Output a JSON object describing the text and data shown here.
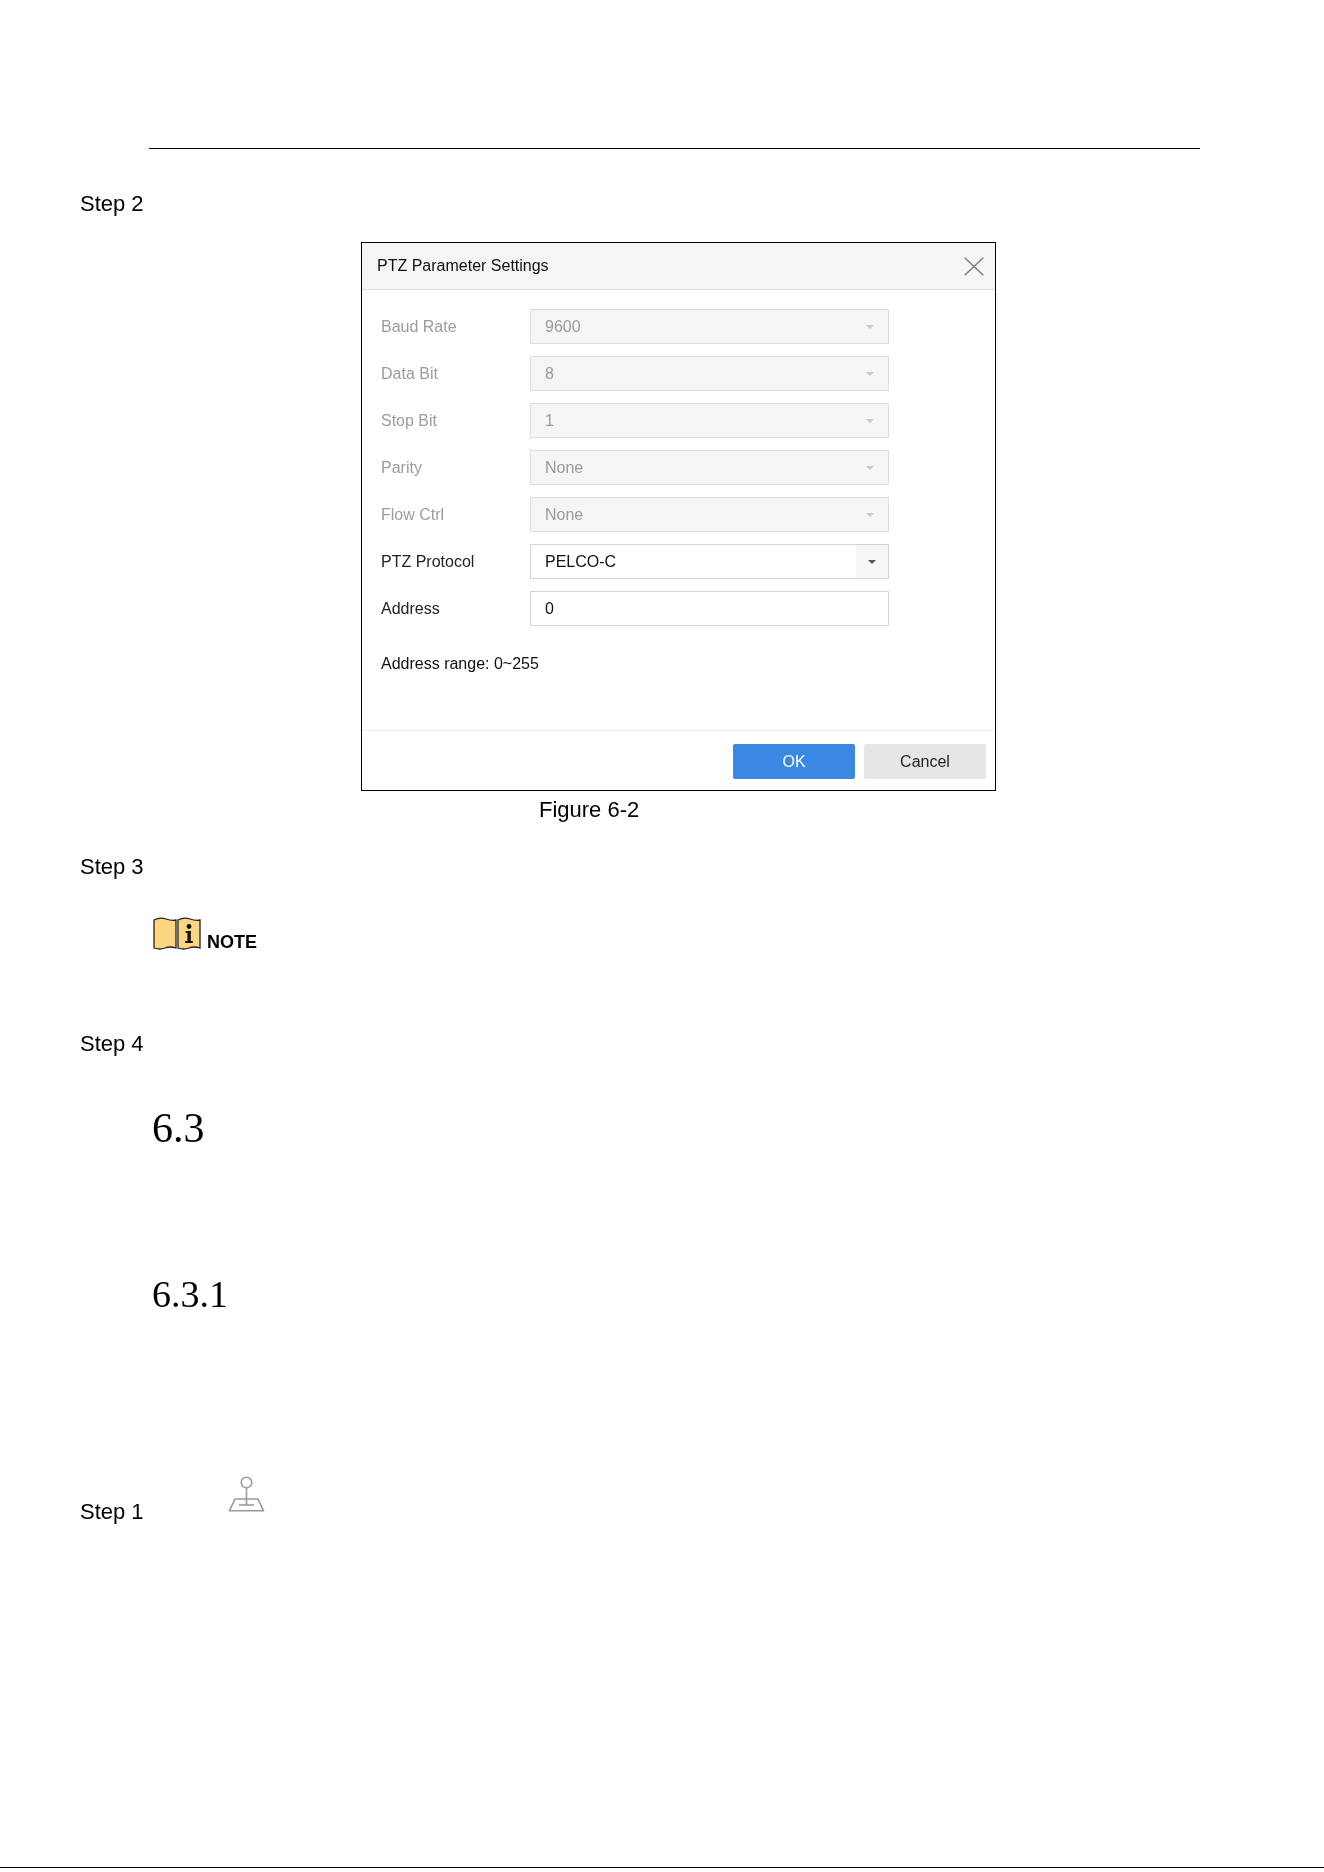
{
  "content": [
    {
      "kind": "step",
      "label": "Step 2"
    },
    {
      "kind": "dialog",
      "title": "PTZ Parameter Settings",
      "fields": [
        {
          "label": "Baud Rate",
          "kind": "select",
          "value": "9600",
          "disabled": true
        },
        {
          "label": "Data Bit",
          "kind": "select",
          "value": "8",
          "disabled": true
        },
        {
          "label": "Stop Bit",
          "kind": "select",
          "value": "1",
          "disabled": true
        },
        {
          "label": "Parity",
          "kind": "select",
          "value": "None",
          "disabled": true
        },
        {
          "label": "Flow Ctrl",
          "kind": "select",
          "value": "None",
          "disabled": true
        },
        {
          "label": "PTZ Protocol",
          "kind": "select",
          "value": "PELCO-C",
          "disabled": false
        },
        {
          "label": "Address",
          "kind": "text",
          "value": "0",
          "disabled": false
        }
      ],
      "hint": "Address range: 0~255",
      "buttons": [
        {
          "label": "OK",
          "primary": true
        },
        {
          "label": "Cancel",
          "primary": false
        }
      ]
    },
    {
      "kind": "caption",
      "text": "Figure 6-2"
    },
    {
      "kind": "step",
      "label": "Step 3"
    },
    {
      "kind": "note",
      "label": "NOTE"
    },
    {
      "kind": "step",
      "label": "Step 4"
    },
    {
      "kind": "heading",
      "text": "6.3"
    },
    {
      "kind": "subheading",
      "text": "6.3.1"
    },
    {
      "kind": "icon_step",
      "label": "Step 1"
    }
  ]
}
